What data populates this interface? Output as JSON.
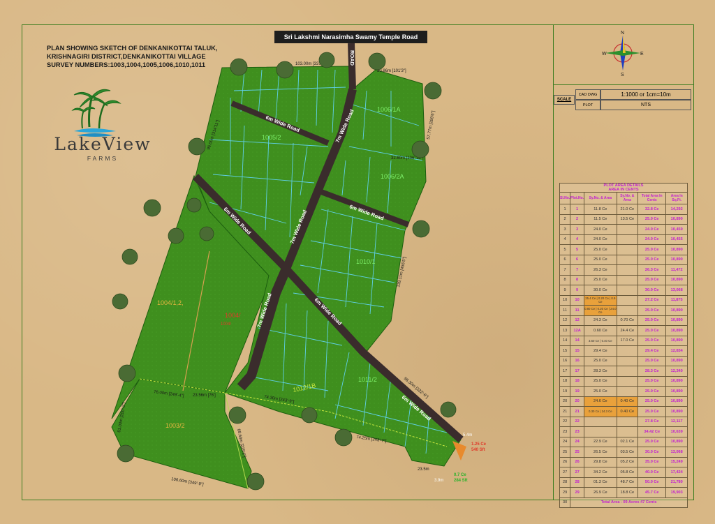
{
  "title": {
    "line1": "PLAN SHOWING SKETCH OF DENKANIKOTTAI TALUK,",
    "line2": "KRISHNAGIRI DISTRICT,DENKANIKOTTAI  VILLAGE",
    "line3": "SURVEY  NUMBERS:1003,1004,1005,1006,1010,1011"
  },
  "top_road": "Sri Lakshmi Narasimha Swamy Temple Road",
  "logo": {
    "name": "LakeView",
    "sub": "FARMS"
  },
  "compass": {
    "n": "N",
    "s": "S",
    "e": "E",
    "w": "W"
  },
  "scale": {
    "label": "SCALE",
    "cad_label": "CAD DWG",
    "cad_value": "1:1000 or 1cm=10m",
    "plot_label": "PLOT",
    "plot_value": "NTS"
  },
  "map_labels": {
    "survey": [
      "1006/1A",
      "1005/2",
      "1006/2A",
      "1010/1",
      "1004/1,2,",
      "1011/2",
      "1012/1B",
      "1004/",
      "1003/2",
      "1004/"
    ],
    "roads": [
      "6m Wide Road",
      "7m Wide Road",
      "6m Wide Road",
      "6m Wide Road",
      "7m Wide Road",
      "6m Wide Road",
      "7m Wide Road",
      "6m Wide Road",
      "ROAD"
    ],
    "dims": [
      "103.00m [337'-11\"]",
      "30.86m [101'3\"]",
      "57.77m [189'6\"]",
      "32.60m [106'-11\"]",
      "96.00m [314'11\"]",
      "139.11m [456'5\"]",
      "98.30m [322'-6\"]",
      "74.30m [243'-9\"]",
      "74.25m [243'-7\"]",
      "76.00m [249'-4\"]",
      "23.56m [76']",
      "61.00m [200'-2\"]",
      "68.60m [225'1\"]",
      "106.60m [349'-9\"]",
      "5.4m",
      "3.9m",
      "23.5m"
    ],
    "red_note": [
      "1.25 Ce",
      "540 Sft"
    ],
    "green_note": [
      "0.7 Ce",
      "284 Sft"
    ]
  },
  "area_table": {
    "title1": "PLOT AREA DETAILS",
    "title2": "AREA IN CENTS",
    "headers": [
      "Sl.No.",
      "Plot.No.",
      "Sy.No. & Area",
      "Sy.No. & Area",
      "Total Area In Cents",
      "Area In Sq.Ft."
    ],
    "rows": [
      [
        "1",
        "1",
        "11.8 Ce",
        "21.0 Ce",
        "32.8 Ce",
        "14,292"
      ],
      [
        "2",
        "2",
        "11.5 Ce",
        "13.5 Ce",
        "25.0 Ce",
        "10,890"
      ],
      [
        "3",
        "3",
        "24.0 Ce",
        "",
        "24.0 Ce",
        "10,459"
      ],
      [
        "4",
        "4",
        "24.0 Ce",
        "",
        "24.0 Ce",
        "10,455"
      ],
      [
        "5",
        "5",
        "25.0 Ce",
        "",
        "25.0 Ce",
        "10,890"
      ],
      [
        "6",
        "6",
        "25.0 Ce",
        "",
        "25.0 Ce",
        "10,890"
      ],
      [
        "7",
        "7",
        "26.3 Ce",
        "",
        "26.3 Ce",
        "11,472"
      ],
      [
        "8",
        "8",
        "25.0 Ce",
        "",
        "25.0 Ce",
        "10,890"
      ],
      [
        "9",
        "9",
        "30.0 Ce",
        "",
        "30.0 Ce",
        "13,068"
      ],
      [
        "10",
        "10",
        "25.4 Ce | 0.20 Ce | 0.9 Ce",
        "",
        "27.2 Ce",
        "11,875"
      ],
      [
        "11",
        "11",
        "0.80 Ce | 0.20 Ce | 24.0 Ce",
        "",
        "25.0 Ce",
        "10,890"
      ],
      [
        "12",
        "12",
        "24.3 Ce",
        "0.70 Ce",
        "25.0 Ce",
        "10,890"
      ],
      [
        "13",
        "12A",
        "0.60 Ce",
        "24.4 Ce",
        "25.0 Ce",
        "10,890"
      ],
      [
        "14",
        "14",
        "3.60 Ce | 0.40 Ce",
        "17.0 Ce",
        "25.0 Ce",
        "10,890"
      ],
      [
        "15",
        "15",
        "29.4 Ce",
        "",
        "29.4 Ce",
        "12,834"
      ],
      [
        "16",
        "16",
        "25.0 Ce",
        "",
        "25.0 Ce",
        "10,890"
      ],
      [
        "17",
        "17",
        "28.3 Ce",
        "",
        "28.3 Ce",
        "12,340"
      ],
      [
        "18",
        "18",
        "25.0 Ce",
        "",
        "25.0 Ce",
        "10,890"
      ],
      [
        "19",
        "19",
        "25.0 Ce",
        "",
        "25.0 Ce",
        "10,890"
      ],
      [
        "20",
        "20",
        "24.6 Ce",
        "0.40 Ce",
        "25.0 Ce",
        "10,890"
      ],
      [
        "21",
        "21",
        "0.30 Ce | 24.3 Ce",
        "0.40 Ce",
        "25.0 Ce",
        "10,890"
      ],
      [
        "22",
        "22",
        "",
        "",
        "27.8 Ce",
        "12,117"
      ],
      [
        "23",
        "23",
        "",
        "",
        "34.42 Ce",
        "10,639"
      ],
      [
        "24",
        "24",
        "22.9 Ce",
        "02.1 Ce",
        "25.0 Ce",
        "10,890"
      ],
      [
        "25",
        "25",
        "26.5 Ce",
        "03.5 Ce",
        "30.0 Ce",
        "13,068"
      ],
      [
        "26",
        "26",
        "29.8 Ce",
        "05.2 Ce",
        "35.0 Ce",
        "15,249"
      ],
      [
        "27",
        "27",
        "34.2 Ce",
        "05.8 Ce",
        "40.0 Ce",
        "17,424"
      ],
      [
        "28",
        "28",
        "01.3 Ce",
        "48.7 Ce",
        "50.0 Ce",
        "21,780"
      ],
      [
        "29",
        "29",
        "26.9 Ce",
        "18.8 Ce",
        "45.7 Ce",
        "19,903"
      ]
    ],
    "total_sl": "30",
    "total": "Total Area - 09 Acres 47 Cents"
  }
}
